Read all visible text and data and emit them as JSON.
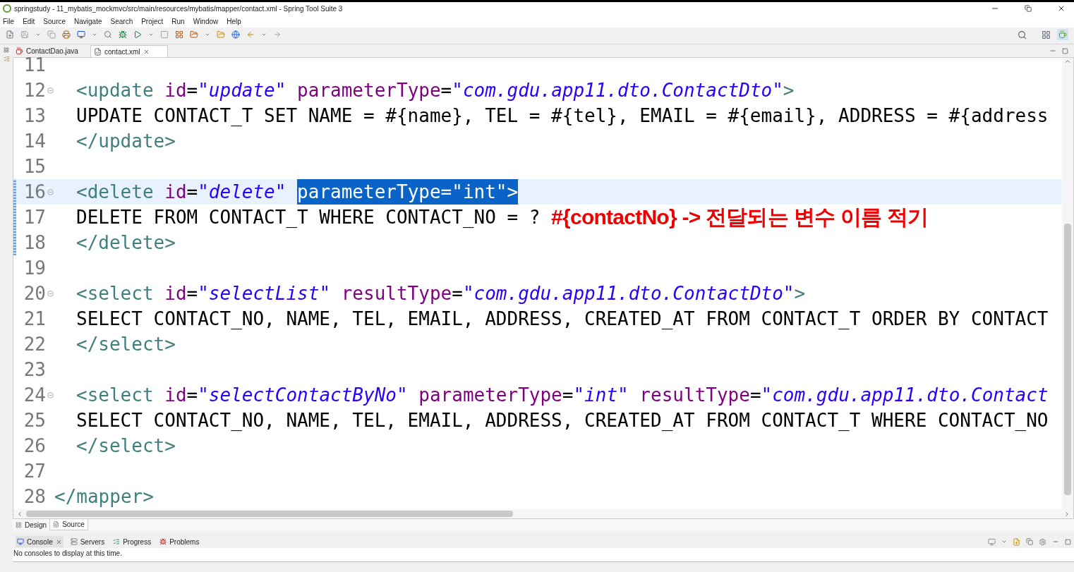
{
  "window": {
    "title": "springstudy - 11_mybatis_mockmvc/src/main/resources/mybatis/mapper/contact.xml - Spring Tool Suite 3"
  },
  "menu": [
    "File",
    "Edit",
    "Source",
    "Navigate",
    "Search",
    "Project",
    "Run",
    "Window",
    "Help"
  ],
  "editor_tabs": [
    {
      "label": "ContactDao.java",
      "selected": false,
      "kind": "java"
    },
    {
      "label": "contact.xml",
      "selected": true,
      "kind": "xml"
    }
  ],
  "editor": {
    "lines": [
      {
        "number": "11",
        "fold": false,
        "current": false,
        "changed": false
      },
      {
        "number": "12",
        "indent": true,
        "fold": true,
        "current": false,
        "changed": false,
        "tokens": [
          {
            "kind": "tag",
            "text": "<update "
          },
          {
            "kind": "attr",
            "text": "id"
          },
          {
            "kind": "plain",
            "text": "="
          },
          {
            "kind": "value",
            "text": "\"update\" "
          },
          {
            "kind": "attr",
            "text": "parameterType"
          },
          {
            "kind": "plain",
            "text": "="
          },
          {
            "kind": "value",
            "text": "\"com.gdu.app11.dto.ContactDto\""
          },
          {
            "kind": "tag",
            "text": ">"
          }
        ]
      },
      {
        "number": "13",
        "indent": true,
        "fold": false,
        "current": false,
        "changed": false,
        "tokens": [
          {
            "kind": "plain",
            "text": "UPDATE CONTACT_T SET NAME = #{name}, TEL = #{tel}, EMAIL = #{email}, ADDRESS = #{address"
          }
        ]
      },
      {
        "number": "14",
        "indent": true,
        "fold": false,
        "current": false,
        "changed": false,
        "tokens": [
          {
            "kind": "tag",
            "text": "</update>"
          }
        ]
      },
      {
        "number": "15",
        "fold": false,
        "current": false,
        "changed": false
      },
      {
        "number": "16",
        "indent": true,
        "fold": true,
        "current": true,
        "changed": true,
        "tokens": [
          {
            "kind": "tag",
            "text": "<delete "
          },
          {
            "kind": "attr",
            "text": "id"
          },
          {
            "kind": "plain",
            "text": "="
          },
          {
            "kind": "value",
            "text": "\"delete\" "
          },
          {
            "kind": "selected",
            "text": "parameterType=\"int\">"
          }
        ]
      },
      {
        "number": "17",
        "indent": true,
        "fold": false,
        "current": false,
        "changed": true,
        "tokens": [
          {
            "kind": "plain",
            "text": "DELETE FROM CONTACT_T WHERE CONTACT_NO = ? "
          },
          {
            "kind": "note",
            "text": "#{contactNo} -> 전달되는 변수 이름 적기"
          }
        ]
      },
      {
        "number": "18",
        "indent": true,
        "fold": false,
        "current": false,
        "changed": true,
        "tokens": [
          {
            "kind": "tag",
            "text": "</delete>"
          }
        ]
      },
      {
        "number": "19",
        "fold": false,
        "current": false,
        "changed": false
      },
      {
        "number": "20",
        "indent": true,
        "fold": true,
        "current": false,
        "changed": false,
        "tokens": [
          {
            "kind": "tag",
            "text": "<select "
          },
          {
            "kind": "attr",
            "text": "id"
          },
          {
            "kind": "plain",
            "text": "="
          },
          {
            "kind": "value",
            "text": "\"selectList\" "
          },
          {
            "kind": "attr",
            "text": "resultType"
          },
          {
            "kind": "plain",
            "text": "="
          },
          {
            "kind": "value",
            "text": "\"com.gdu.app11.dto.ContactDto\""
          },
          {
            "kind": "tag",
            "text": ">"
          }
        ]
      },
      {
        "number": "21",
        "indent": true,
        "fold": false,
        "current": false,
        "changed": false,
        "tokens": [
          {
            "kind": "plain",
            "text": "SELECT CONTACT_NO, NAME, TEL, EMAIL, ADDRESS, CREATED_AT FROM CONTACT_T ORDER BY CONTACT"
          }
        ]
      },
      {
        "number": "22",
        "indent": true,
        "fold": false,
        "current": false,
        "changed": false,
        "tokens": [
          {
            "kind": "tag",
            "text": "</select>"
          }
        ]
      },
      {
        "number": "23",
        "fold": false,
        "current": false,
        "changed": false
      },
      {
        "number": "24",
        "indent": true,
        "fold": true,
        "current": false,
        "changed": false,
        "tokens": [
          {
            "kind": "tag",
            "text": "<select "
          },
          {
            "kind": "attr",
            "text": "id"
          },
          {
            "kind": "plain",
            "text": "="
          },
          {
            "kind": "value",
            "text": "\"selectContactByNo\" "
          },
          {
            "kind": "attr",
            "text": "parameterType"
          },
          {
            "kind": "plain",
            "text": "="
          },
          {
            "kind": "value",
            "text": "\"int\" "
          },
          {
            "kind": "attr",
            "text": "resultType"
          },
          {
            "kind": "plain",
            "text": "="
          },
          {
            "kind": "value",
            "text": "\"com.gdu.app11.dto.Contact"
          }
        ]
      },
      {
        "number": "25",
        "indent": true,
        "fold": false,
        "current": false,
        "changed": false,
        "tokens": [
          {
            "kind": "plain",
            "text": "SELECT CONTACT_NO, NAME, TEL, EMAIL, ADDRESS, CREATED_AT FROM CONTACT_T WHERE CONTACT_NO"
          }
        ]
      },
      {
        "number": "26",
        "indent": true,
        "fold": false,
        "current": false,
        "changed": false,
        "tokens": [
          {
            "kind": "tag",
            "text": "</select>"
          }
        ]
      },
      {
        "number": "27",
        "fold": false,
        "current": false,
        "changed": false
      },
      {
        "number": "28",
        "indent": false,
        "fold": false,
        "current": false,
        "changed": false,
        "tokens": [
          {
            "kind": "tag",
            "text": "</mapper>"
          }
        ]
      }
    ]
  },
  "view_tabs": [
    {
      "label": "Design",
      "selected": false
    },
    {
      "label": "Source",
      "selected": true
    }
  ],
  "console": {
    "tabs": [
      {
        "label": "Console",
        "selected": true
      },
      {
        "label": "Servers",
        "selected": false
      },
      {
        "label": "Progress",
        "selected": false
      },
      {
        "label": "Problems",
        "selected": false
      }
    ],
    "message": "No consoles to display at this time."
  }
}
